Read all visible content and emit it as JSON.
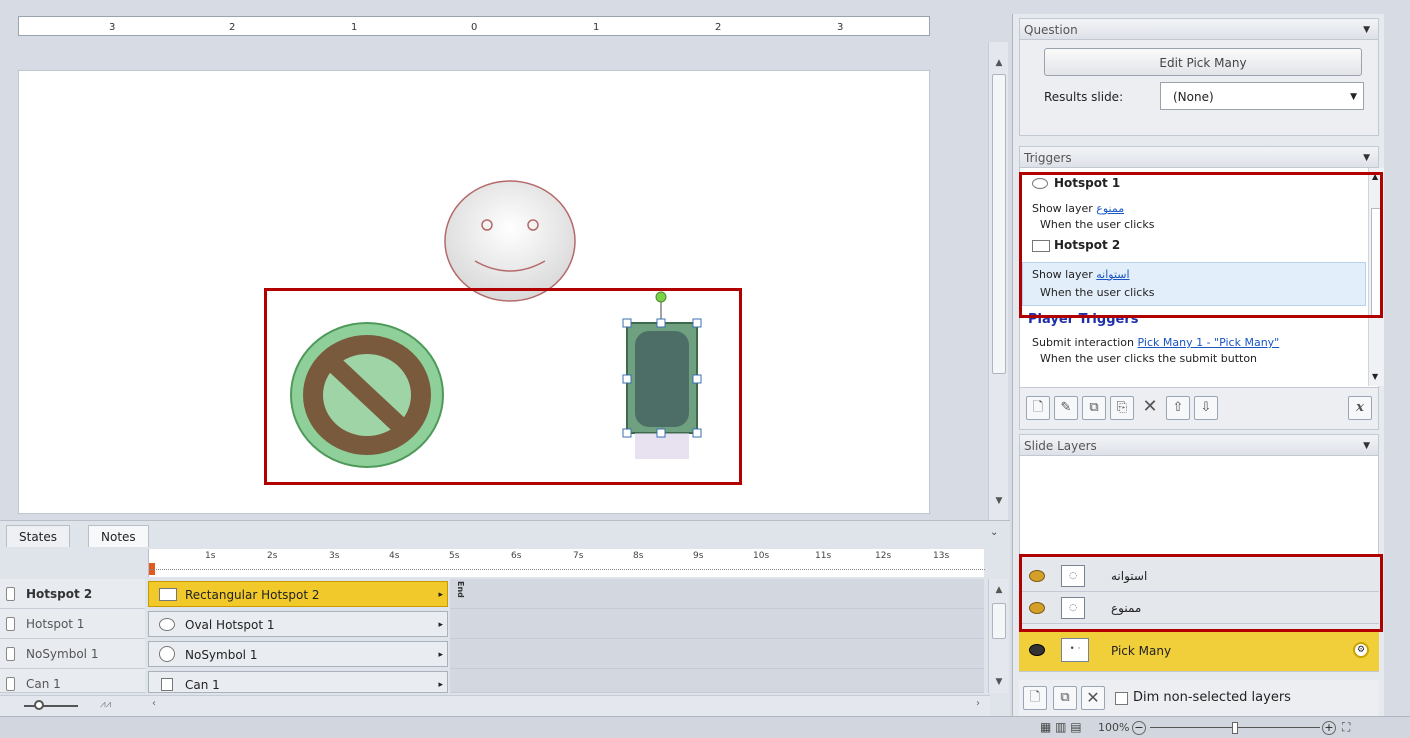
{
  "ruler": {
    "marks": [
      "3",
      "2",
      "1",
      "0",
      "1",
      "2",
      "3"
    ]
  },
  "timeline": {
    "tabs": [
      "States",
      "Notes"
    ],
    "seconds": [
      "1s",
      "2s",
      "3s",
      "4s",
      "5s",
      "6s",
      "7s",
      "8s",
      "9s",
      "10s",
      "11s",
      "12s",
      "13s"
    ],
    "end_label": "End",
    "rows": [
      {
        "name": "Hotspot 2",
        "bar": "Rectangular Hotspot 2"
      },
      {
        "name": "Hotspot 1",
        "bar": "Oval Hotspot 1"
      },
      {
        "name": "NoSymbol 1",
        "bar": "NoSymbol 1"
      },
      {
        "name": "Can 1",
        "bar": "Can 1"
      }
    ]
  },
  "question": {
    "header": "Question",
    "edit_button": "Edit Pick Many",
    "results_label": "Results slide:",
    "results_value": "(None)"
  },
  "triggers": {
    "header": "Triggers",
    "items": [
      {
        "title": "Hotspot 1",
        "action": "Show layer",
        "target": "ممنوع",
        "condition": "When the user clicks"
      },
      {
        "title": "Hotspot 2",
        "action": "Show layer",
        "target": "استوانه",
        "condition": "When the user clicks"
      }
    ],
    "player_header": "Player Triggers",
    "player_action": "Submit interaction",
    "player_target": "Pick Many 1 - \"Pick Many\"",
    "player_condition": "When the user clicks the submit button",
    "variable_icon": "x"
  },
  "layers": {
    "header": "Slide Layers",
    "items": [
      {
        "name": "استوانه"
      },
      {
        "name": "ممنوع"
      },
      {
        "name": "Pick Many"
      }
    ],
    "dim_label": "Dim non-selected layers"
  },
  "status": {
    "zoom": "100%"
  },
  "colors": {
    "highlight": "#b00000",
    "selected_layer": "#f0cf3a",
    "selected_bar": "#f2c92b"
  }
}
